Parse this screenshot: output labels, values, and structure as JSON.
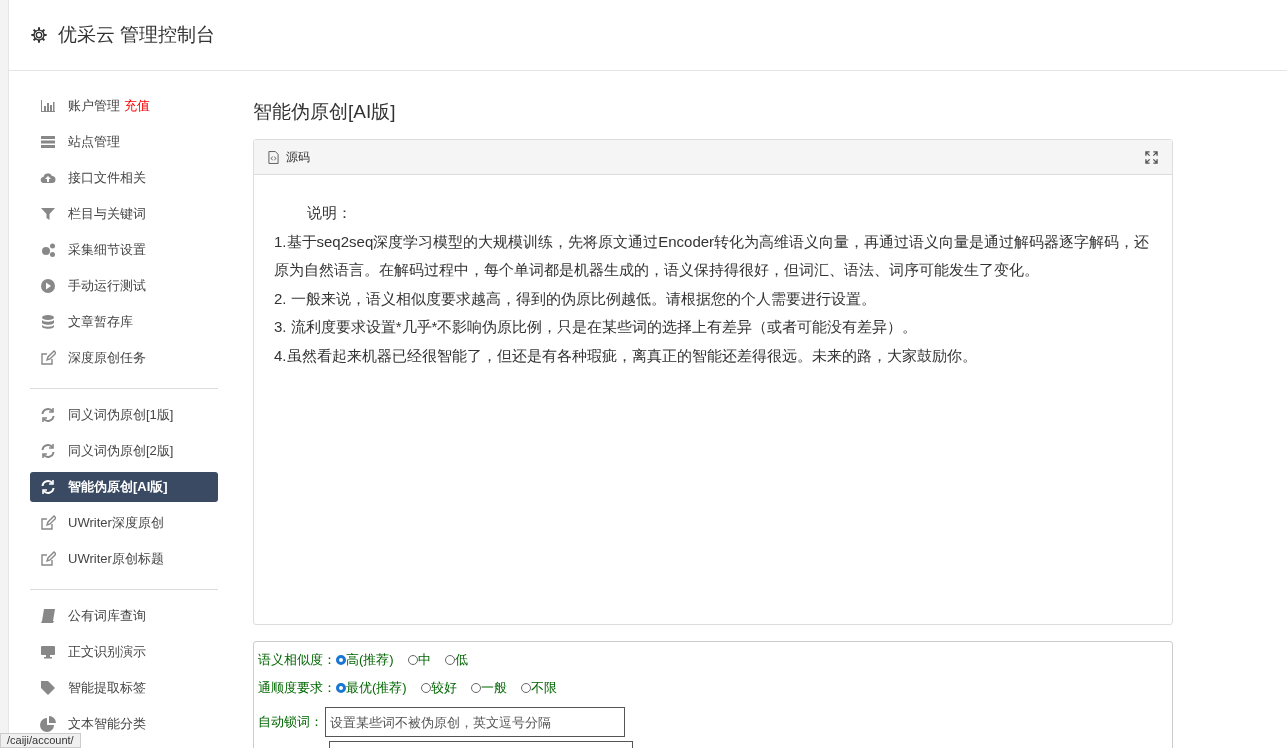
{
  "header": {
    "title": "优采云 管理控制台"
  },
  "sidebar": {
    "groups": [
      {
        "items": [
          {
            "label": "账户管理",
            "badge": "充值",
            "selected": false
          },
          {
            "label": "站点管理",
            "selected": false
          },
          {
            "label": "接口文件相关",
            "selected": false
          },
          {
            "label": "栏目与关键词",
            "selected": false
          },
          {
            "label": "采集细节设置",
            "selected": false
          },
          {
            "label": "手动运行测试",
            "selected": false
          },
          {
            "label": "文章暂存库",
            "selected": false
          },
          {
            "label": "深度原创任务",
            "selected": false
          }
        ]
      },
      {
        "items": [
          {
            "label": "同义词伪原创[1版]",
            "selected": false
          },
          {
            "label": "同义词伪原创[2版]",
            "selected": false
          },
          {
            "label": "智能伪原创[AI版]",
            "selected": true
          },
          {
            "label": "UWriter深度原创",
            "selected": false
          },
          {
            "label": "UWriter原创标题",
            "selected": false
          }
        ]
      },
      {
        "items": [
          {
            "label": "公有词库查询",
            "selected": false
          },
          {
            "label": "正文识别演示",
            "selected": false
          },
          {
            "label": "智能提取标签",
            "selected": false
          },
          {
            "label": "文本智能分类",
            "selected": false
          }
        ]
      }
    ]
  },
  "page_title": "智能伪原创[AI版]",
  "editor": {
    "toolbar_label": "源码",
    "heading": "说明：",
    "paragraphs": [
      "1.基于seq2seq深度学习模型的大规模训练，先将原文通过Encoder转化为高维语义向量，再通过语义向量是通过解码器逐字解码，还原为自然语言。在解码过程中，每个单词都是机器生成的，语义保持得很好，但词汇、语法、词序可能发生了变化。",
      "2. 一般来说，语义相似度要求越高，得到的伪原比例越低。请根据您的个人需要进行设置。",
      "3. 流利度要求设置*几乎*不影响伪原比例，只是在某些词的选择上有差异（或者可能没有差异）。",
      "4.虽然看起来机器已经很智能了，但还是有各种瑕疵，离真正的智能还差得很远。未来的路，大家鼓励你。"
    ]
  },
  "options": {
    "radio_groups": [
      {
        "label": "语义相似度：",
        "choices": [
          {
            "label": "高(推荐)",
            "selected": true
          },
          {
            "label": "中",
            "selected": false
          },
          {
            "label": "低",
            "selected": false
          }
        ]
      },
      {
        "label": "通顺度要求：",
        "choices": [
          {
            "label": "最优(推荐)",
            "selected": true
          },
          {
            "label": "较好",
            "selected": false
          },
          {
            "label": "一般",
            "selected": false
          },
          {
            "label": "不限",
            "selected": false
          }
        ]
      }
    ],
    "lock_words": {
      "label": "自动锁词：",
      "placeholder": "设置某些词不被伪原创，英文逗号分隔"
    }
  },
  "status_url": "/caiji/account/"
}
